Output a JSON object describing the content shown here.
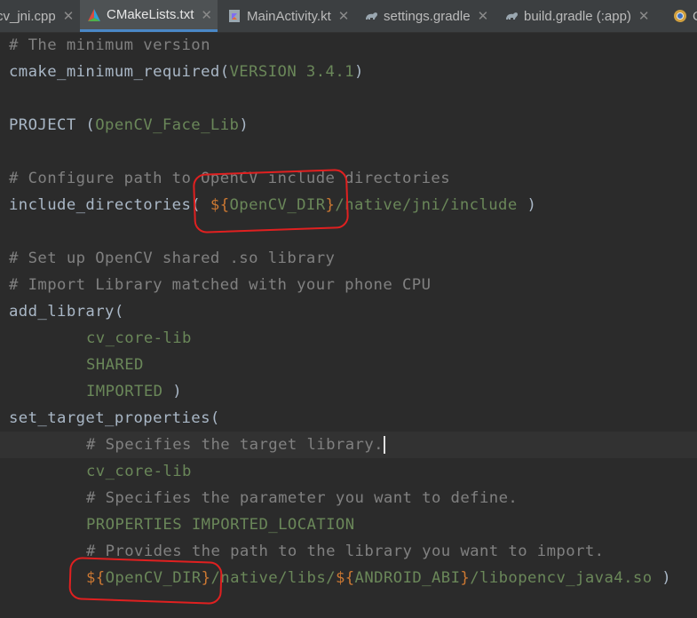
{
  "tabs": [
    {
      "label": "cv_jni.cpp",
      "icon": "cpp-file-icon",
      "active": false
    },
    {
      "label": "CMakeLists.txt",
      "icon": "cmake-icon",
      "active": true
    },
    {
      "label": "MainActivity.kt",
      "icon": "kotlin-file-icon",
      "active": false
    },
    {
      "label": "settings.gradle",
      "icon": "gradle-icon",
      "active": false
    },
    {
      "label": "build.gradle (:app)",
      "icon": "gradle-icon",
      "active": false
    },
    {
      "label": "C",
      "icon": "chrome-icon",
      "active": false
    }
  ],
  "code": {
    "l1": "# The minimum version",
    "l2_fn": "cmake_minimum_required(",
    "l2_arg": "VERSION 3.4.1",
    "l2_end": ")",
    "l4_fn": "PROJECT (",
    "l4_arg": "OpenCV_Face_Lib",
    "l4_end": ")",
    "l6": "# Configure path to OpenCV include directories",
    "l7_fn": "include_directories( ",
    "l7_dollar": "${",
    "l7_var": "OpenCV_DIR",
    "l7_close": "}",
    "l7_path": "/native/jni/include",
    "l7_end": " )",
    "l9": "# Set up OpenCV shared .so library",
    "l10": "# Import Library matched with your phone CPU",
    "l11": "add_library(",
    "l12": "cv_core-lib",
    "l13": "SHARED",
    "l14_arg": "IMPORTED",
    "l14_end": " )",
    "l15": "set_target_properties(",
    "l16": "# Specifies the target library.",
    "l17": "cv_core-lib",
    "l18": "# Specifies the parameter you want to define.",
    "l19": "PROPERTIES IMPORTED_LOCATION",
    "l20": "# Provides the path to the library you want to import.",
    "l21_d1": "${",
    "l21_v1": "OpenCV_DIR",
    "l21_c1": "}",
    "l21_p1": "/native/libs/",
    "l21_d2": "${",
    "l21_v2": "ANDROID_ABI",
    "l21_c2": "}",
    "l21_p2": "/libopencv_java4.so",
    "l21_end": " )"
  },
  "colors": {
    "background": "#2b2b2b",
    "comment": "#808080",
    "string": "#6a8759",
    "variable_delimiter": "#cc7832",
    "annotation": "#e02020"
  }
}
